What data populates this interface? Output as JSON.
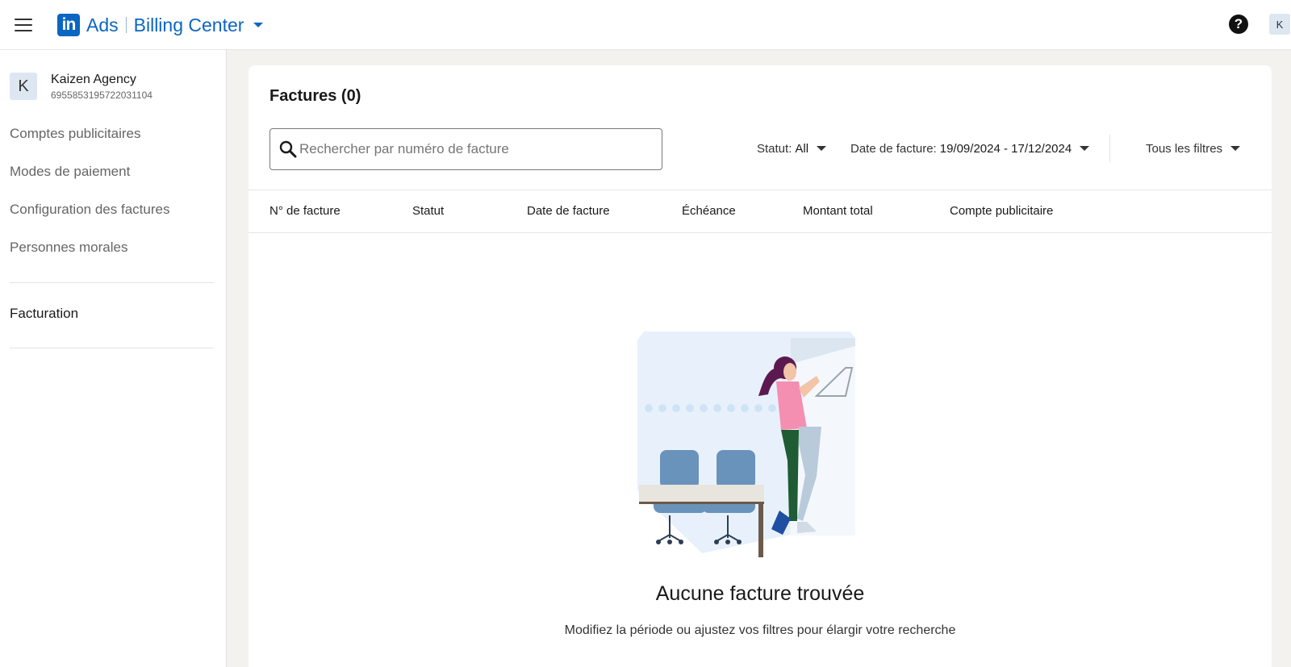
{
  "header": {
    "logo_text": "in",
    "ads_label": "Ads",
    "title": "Billing Center",
    "help_symbol": "?",
    "user_initial": "K",
    "brand_color": "#0a66c2"
  },
  "sidebar": {
    "account": {
      "initial": "K",
      "name": "Kaizen Agency",
      "id": "6955853195722031104"
    },
    "items": [
      {
        "label": "Comptes publicitaires"
      },
      {
        "label": "Modes de paiement"
      },
      {
        "label": "Configuration des factures"
      },
      {
        "label": "Personnes morales"
      }
    ],
    "active_item": {
      "label": "Facturation"
    }
  },
  "main": {
    "title": "Factures (0)",
    "search": {
      "placeholder": "Rechercher par numéro de facture",
      "value": ""
    },
    "filters": {
      "status": {
        "label": "Statut:",
        "value": "All"
      },
      "date": {
        "label": "Date de facture:",
        "value": "19/09/2024 - 17/12/2024"
      },
      "all_filters": {
        "label": "Tous les filtres"
      }
    },
    "table": {
      "columns": [
        "N° de facture",
        "Statut",
        "Date de facture",
        "Échéance",
        "Montant total",
        "Compte publicitaire"
      ],
      "rows": []
    },
    "empty_state": {
      "title": "Aucune facture trouvée",
      "subtitle": "Modifiez la période ou ajustez vos filtres pour élargir votre recherche"
    }
  },
  "icons": {
    "menu": "hamburger-menu-icon",
    "help": "help-circle-icon",
    "search": "magnifier-icon",
    "dropdown": "caret-down-icon"
  }
}
